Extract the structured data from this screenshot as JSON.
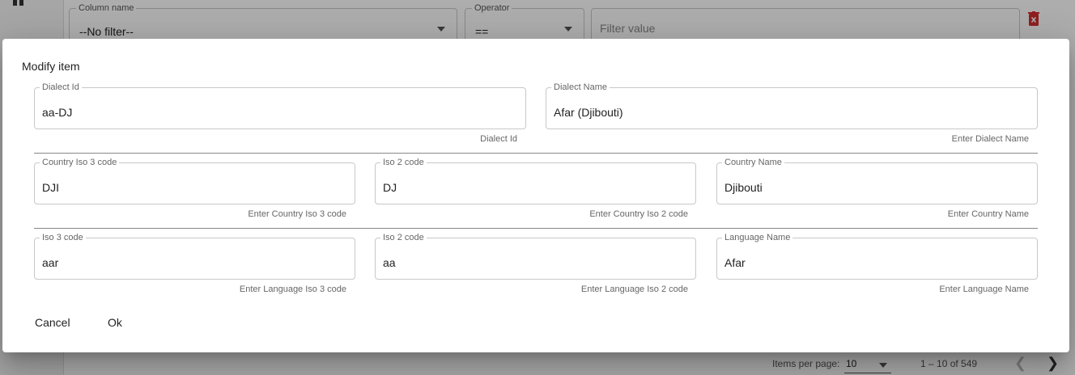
{
  "background": {
    "filter_column": {
      "label": "Column name",
      "value": "--No filter--"
    },
    "filter_operator": {
      "label": "Operator",
      "value": "=="
    },
    "filter_value": {
      "placeholder": "Filter value"
    },
    "paginator": {
      "items_per_page_label": "Items per page:",
      "items_per_page_value": "10",
      "range_label": "1 – 10 of 549"
    }
  },
  "dialog": {
    "title": "Modify item",
    "fields": {
      "dialect_id": {
        "label": "Dialect Id",
        "value": "aa-DJ",
        "hint": "Dialect Id"
      },
      "dialect_name": {
        "label": "Dialect Name",
        "value": "Afar (Djibouti)",
        "hint": "Enter Dialect Name"
      },
      "country_iso3": {
        "label": "Country Iso 3 code",
        "value": "DJI",
        "hint": "Enter Country Iso 3 code"
      },
      "country_iso2": {
        "label": "Iso 2 code",
        "value": "DJ",
        "hint": "Enter Country Iso 2 code"
      },
      "country_name": {
        "label": "Country Name",
        "value": "Djibouti",
        "hint": "Enter Country Name"
      },
      "language_iso3": {
        "label": "Iso 3 code",
        "value": "aar",
        "hint": "Enter Language Iso 3 code"
      },
      "language_iso2": {
        "label": "Iso 2 code",
        "value": "aa",
        "hint": "Enter Language Iso 2 code"
      },
      "language_name": {
        "label": "Language Name",
        "value": "Afar",
        "hint": "Enter Language Name"
      }
    },
    "cancel_label": "Cancel",
    "ok_label": "Ok"
  },
  "colors": {
    "delete_icon": "#d32f2f",
    "overlay": "#000000"
  }
}
